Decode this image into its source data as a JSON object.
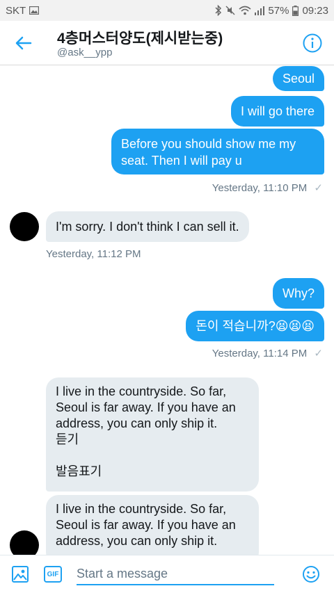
{
  "status_bar": {
    "carrier": "SKT",
    "battery": "57%",
    "time": "09:23"
  },
  "header": {
    "title": "4층머스터양도(제시받는중)",
    "handle": "@ask__ypp"
  },
  "messages": [
    {
      "direction": "outgoing",
      "text": "Seoul"
    },
    {
      "direction": "outgoing",
      "text": "I will go there"
    },
    {
      "direction": "outgoing",
      "text": "Before you should show me my seat. Then I will pay u"
    },
    {
      "direction": "outgoing-timestamp",
      "text": "Yesterday, 11:10 PM"
    },
    {
      "direction": "incoming",
      "text": "I'm sorry. I don't think I can sell it."
    },
    {
      "direction": "incoming-timestamp",
      "text": "Yesterday, 11:12 PM"
    },
    {
      "direction": "outgoing",
      "text": "Why?"
    },
    {
      "direction": "outgoing",
      "text": "돈이 적습니까?😫😫😫"
    },
    {
      "direction": "outgoing-timestamp",
      "text": "Yesterday, 11:14 PM"
    },
    {
      "direction": "incoming",
      "text": "I live in the countryside. So far,\nSeoul is far away. If you have an\naddress, you can only ship it.\n듣기\n\n발음표기"
    },
    {
      "direction": "incoming",
      "text": "I live in the countryside. So far,\nSeoul is far away. If you have an\naddress, you can only ship it."
    }
  ],
  "composer": {
    "placeholder": "Start a message",
    "gif_label": "GIF"
  },
  "colors": {
    "accent": "#1da1f2",
    "incoming_bubble": "#e6ecf0"
  }
}
